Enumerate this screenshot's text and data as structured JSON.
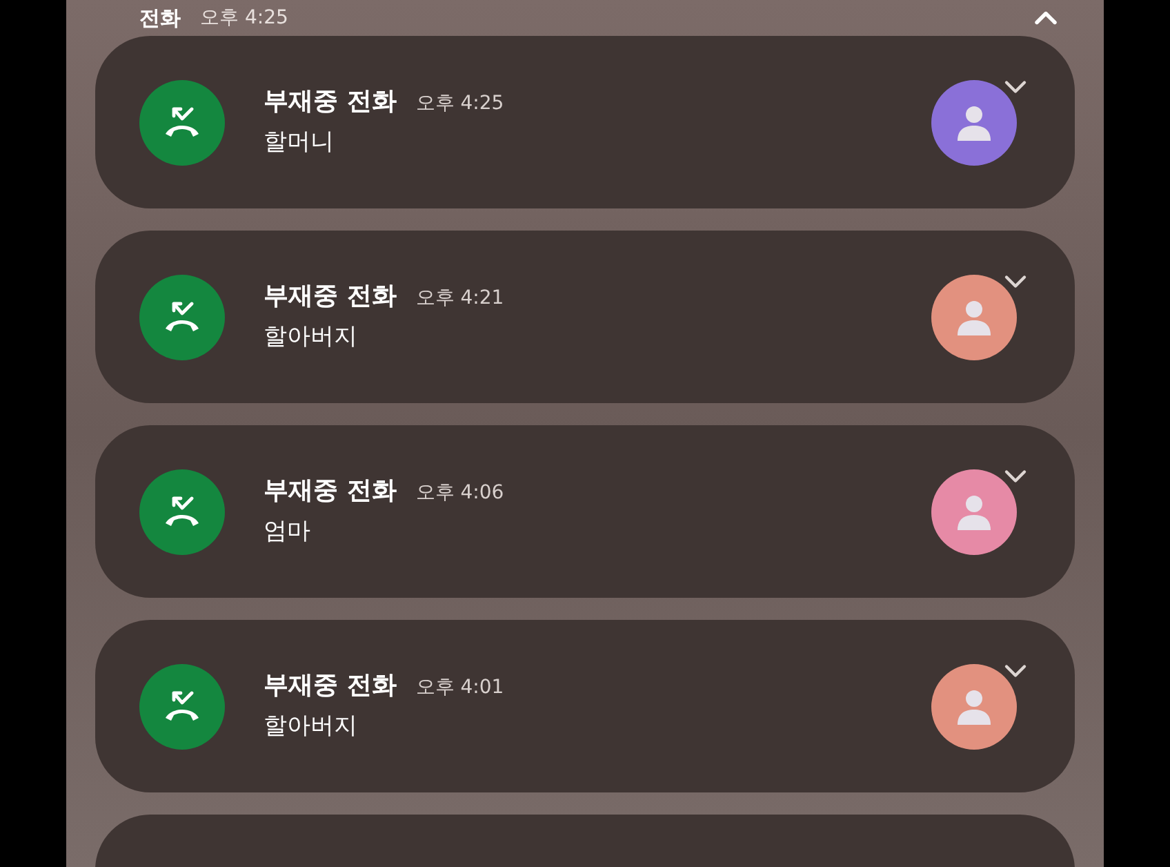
{
  "header": {
    "title": "전화",
    "time": "오후 4:25"
  },
  "notifications": [
    {
      "title": "부재중 전화",
      "time": "오후 4:25",
      "caller": "할머니",
      "color": "#8a70d8"
    },
    {
      "title": "부재중 전화",
      "time": "오후 4:21",
      "caller": "할아버지",
      "color": "#e2917f"
    },
    {
      "title": "부재중 전화",
      "time": "오후 4:06",
      "caller": "엄마",
      "color": "#e68aa6"
    },
    {
      "title": "부재중 전화",
      "time": "오후 4:01",
      "caller": "할아버지",
      "color": "#e2917f"
    }
  ]
}
